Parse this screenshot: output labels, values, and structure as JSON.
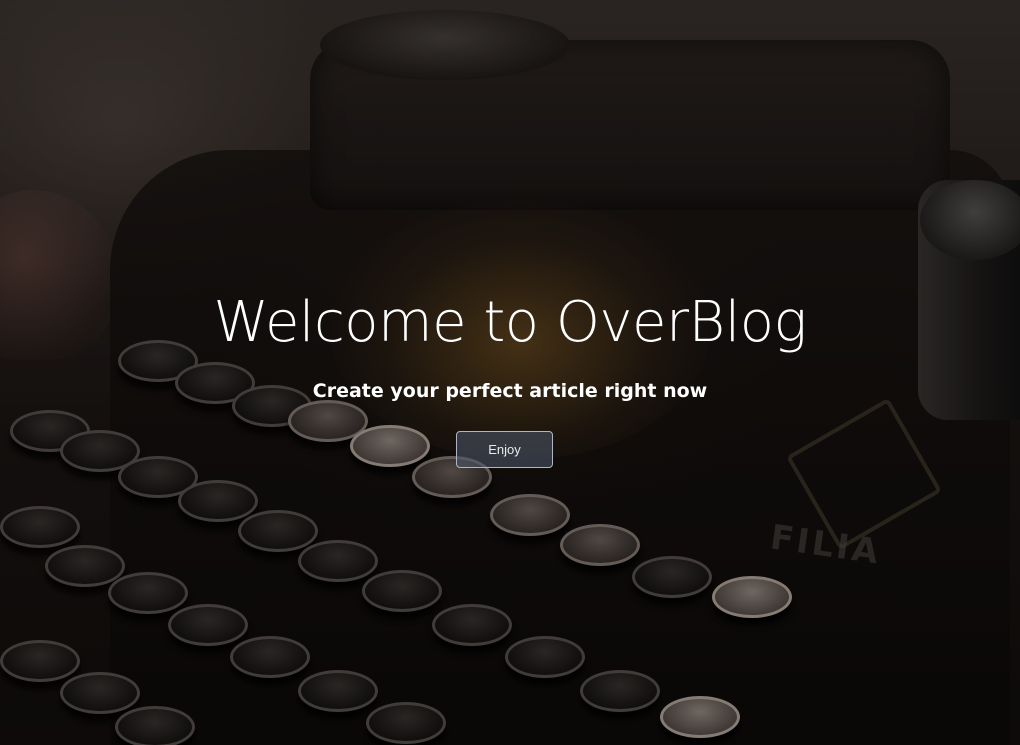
{
  "hero": {
    "title": "Welcome to OverBlog",
    "subtitle": "Create your perfect article right now",
    "cta_label": "Enjoy"
  },
  "background": {
    "brand_text": "FILIA"
  },
  "colors": {
    "title": "#ffffff",
    "subtitle": "#ffffff",
    "button_border": "#aeb6c4",
    "button_text": "#e6e9ef"
  }
}
